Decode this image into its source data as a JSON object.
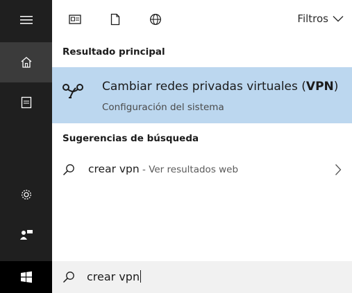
{
  "left_rail": {
    "items": [
      {
        "name": "menu",
        "icon": "hamburger-menu-icon"
      },
      {
        "name": "home",
        "icon": "home-icon"
      },
      {
        "name": "documents",
        "icon": "document-icon"
      },
      {
        "name": "settings",
        "icon": "gear-icon"
      },
      {
        "name": "feedback",
        "icon": "feedback-icon"
      },
      {
        "name": "start",
        "icon": "windows-logo-icon"
      }
    ]
  },
  "toolbar": {
    "icons": [
      "apps-icon",
      "document-icon",
      "web-globe-icon"
    ],
    "filters_label": "Filtros"
  },
  "best_match": {
    "header": "Resultado principal",
    "title_prefix": "Cambiar redes privadas virtuales (",
    "title_bold": "VPN",
    "title_suffix": ")",
    "subtitle": "Configuración del sistema",
    "icon": "vpn-icon"
  },
  "suggestions": {
    "header": "Sugerencias de búsqueda",
    "items": [
      {
        "query": "crear vpn",
        "hint": " - Ver resultados web"
      }
    ]
  },
  "search_box": {
    "value": "crear vpn"
  },
  "colors": {
    "rail_bg": "#1f1f1f",
    "rail_active": "#3b3b3b",
    "selected_bg": "#bcd7ef",
    "searchbar_bg": "#f1f1f1"
  }
}
